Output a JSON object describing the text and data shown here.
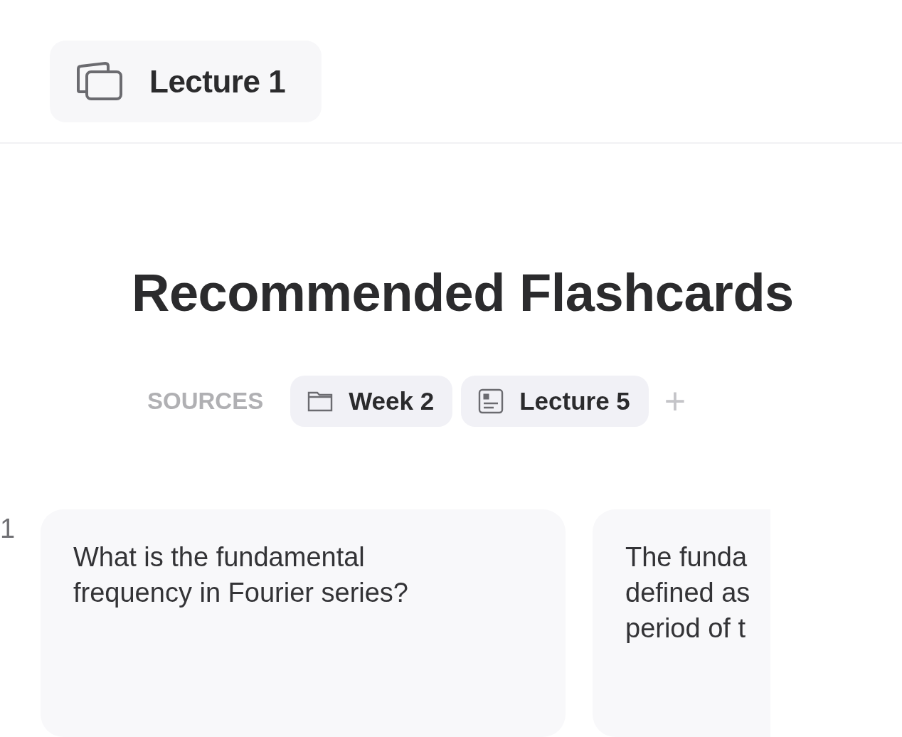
{
  "header": {
    "title": "Lecture 1"
  },
  "heading": "Recommended Flashcards",
  "sources": {
    "label": "SOURCES",
    "items": [
      {
        "kind": "folder",
        "label": "Week 2"
      },
      {
        "kind": "document",
        "label": "Lecture 5"
      }
    ],
    "add": "+"
  },
  "flashcards": [
    {
      "number": "1",
      "question": [
        "What is the fundamental",
        "frequency in Fourier series?"
      ],
      "answer": [
        "The funda",
        "defined as",
        "period of t"
      ]
    }
  ]
}
